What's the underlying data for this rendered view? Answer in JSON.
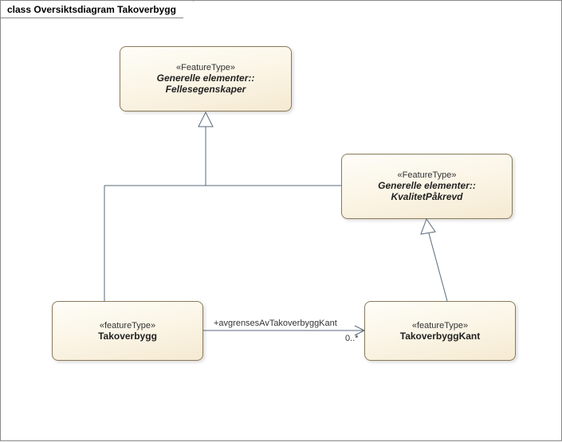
{
  "diagram": {
    "title_prefix": "class",
    "title_name": "Oversiktsdiagram Takoverbygg"
  },
  "classes": {
    "fellesegenskaper": {
      "stereotype": "«FeatureType»",
      "package": "Generelle elementer::",
      "name": "Fellesegenskaper"
    },
    "kvalitetpakrevd": {
      "stereotype": "«FeatureType»",
      "package": "Generelle elementer::",
      "name": "KvalitetPåkrevd"
    },
    "takoverbygg": {
      "stereotype": "«featureType»",
      "name": "Takoverbygg"
    },
    "takoverbyggkant": {
      "stereotype": "«featureType»",
      "name": "TakoverbyggKant"
    }
  },
  "associations": {
    "avgrenses": {
      "role": "+avgrensesAvTakoverbyggKant",
      "multiplicity": "0..*"
    }
  }
}
